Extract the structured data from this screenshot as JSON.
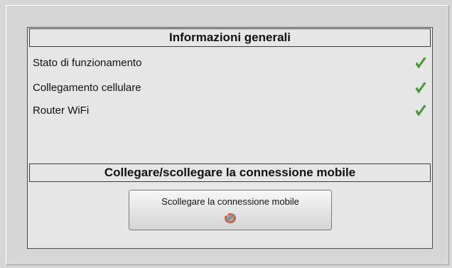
{
  "general_info": {
    "title": "Informazioni generali",
    "items": [
      {
        "label": "Stato di funzionamento",
        "status_icon": "green-check-icon"
      },
      {
        "label": "Collegamento cellulare",
        "status_icon": "green-check-icon"
      },
      {
        "label": "Router WiFi",
        "status_icon": "green-check-icon"
      }
    ]
  },
  "mobile_connection": {
    "title": "Collegare/scollegare la connessione mobile",
    "button_label": "Scollegare la connessione mobile",
    "button_icon": "plug-disconnect-icon"
  },
  "colors": {
    "check_green": "#3fae2a",
    "background": "#d6d6d6",
    "panel": "#e6e6e6"
  }
}
